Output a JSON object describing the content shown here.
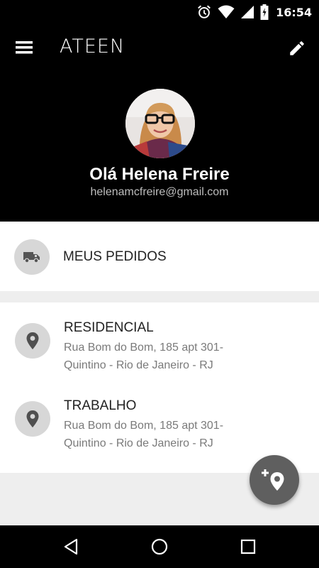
{
  "status_bar": {
    "time": "16:54",
    "icons": [
      "alarm-icon",
      "wifi-icon",
      "signal-icon",
      "battery-icon"
    ]
  },
  "app_bar": {
    "brand": "ATEEN",
    "menu_icon": "hamburger-menu-icon",
    "edit_icon": "pencil-icon"
  },
  "profile": {
    "greeting": "Olá Helena Freire",
    "email": "helenamcfreire@gmail.com"
  },
  "orders": {
    "label": "MEUS PEDIDOS",
    "icon": "truck-icon"
  },
  "addresses": [
    {
      "title": "RESIDENCIAL",
      "line1": "Rua Bom do Bom, 185 apt 301-",
      "line2": "Quintino - Rio de Janeiro - RJ",
      "icon": "location-pin-icon"
    },
    {
      "title": "TRABALHO",
      "line1": "Rua Bom do Bom, 185 apt 301-",
      "line2": "Quintino - Rio de Janeiro - RJ",
      "icon": "location-pin-icon"
    }
  ],
  "fab": {
    "icon": "add-location-icon"
  },
  "nav_bar": {
    "icons": [
      "back-icon",
      "home-icon",
      "recents-icon"
    ]
  },
  "colors": {
    "header": "#000000",
    "icon_circle": "#d7d7d7",
    "fab": "#5f5f5f",
    "background": "#eeeeee"
  }
}
